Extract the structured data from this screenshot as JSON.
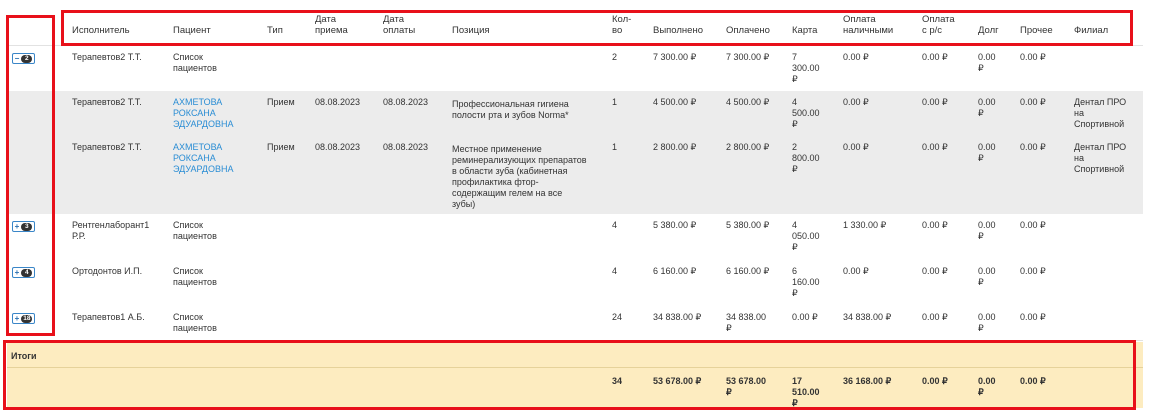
{
  "columns": [
    "Исполнитель",
    "Пациент",
    "Тип",
    "Дата\nприема",
    "Дата\nоплаты",
    "Позиция",
    "Кол-\nво",
    "Выполнено",
    "Оплачено",
    "Карта",
    "Оплата\nналичными",
    "Оплата\nс р/с",
    "Долг",
    "Прочее",
    "Филиал"
  ],
  "rows": [
    {
      "toggle": {
        "sign": "−",
        "count": "2"
      },
      "performer": "Терапевтов2 Т.Т.",
      "patient": "Список\nпациентов",
      "patient_link": false,
      "type": "",
      "date_visit": "",
      "date_pay": "",
      "position": "",
      "qty": "2",
      "done": "7 300.00 ₽",
      "paid": "7 300.00 ₽",
      "card": "7\n300.00\n₽",
      "cash": "0.00 ₽",
      "bank": "0.00 ₽",
      "debt": "0.00\n₽",
      "other": "0.00 ₽",
      "branch": ""
    },
    {
      "toggle": null,
      "performer": "Терапевтов2 Т.Т.",
      "patient": "АХМЕТОВА\nРОКСАНА\nЭДУАРДОВНА",
      "patient_link": true,
      "type": "Прием",
      "date_visit": "08.08.2023",
      "date_pay": "08.08.2023",
      "position": "Профессиональная гигиена\nполости рта и зубов Norma*",
      "qty": "1",
      "done": "4 500.00 ₽",
      "paid": "4 500.00 ₽",
      "card": "4\n500.00\n₽",
      "cash": "0.00 ₽",
      "bank": "0.00 ₽",
      "debt": "0.00\n₽",
      "other": "0.00 ₽",
      "branch": "Дентал ПРО\nна\nСпортивной"
    },
    {
      "toggle": null,
      "performer": "Терапевтов2 Т.Т.",
      "patient": "АХМЕТОВА\nРОКСАНА\nЭДУАРДОВНА",
      "patient_link": true,
      "type": "Прием",
      "date_visit": "08.08.2023",
      "date_pay": "08.08.2023",
      "position": "Местное применение\nреминерализующих препаратов\nв области зуба (кабинетная\nпрофилактика фтор-\nсодержащим гелем на все\nзубы)",
      "qty": "1",
      "done": "2 800.00 ₽",
      "paid": "2 800.00 ₽",
      "card": "2\n800.00\n₽",
      "cash": "0.00 ₽",
      "bank": "0.00 ₽",
      "debt": "0.00\n₽",
      "other": "0.00 ₽",
      "branch": "Дентал ПРО\nна\nСпортивной"
    },
    {
      "toggle": {
        "sign": "+",
        "count": "3"
      },
      "performer": "Рентгенлаборант1\nР.Р.",
      "patient": "Список\nпациентов",
      "patient_link": false,
      "type": "",
      "date_visit": "",
      "date_pay": "",
      "position": "",
      "qty": "4",
      "done": "5 380.00 ₽",
      "paid": "5 380.00 ₽",
      "card": "4\n050.00\n₽",
      "cash": "1 330.00 ₽",
      "bank": "0.00 ₽",
      "debt": "0.00\n₽",
      "other": "0.00 ₽",
      "branch": ""
    },
    {
      "toggle": {
        "sign": "+",
        "count": "4"
      },
      "performer": "Ортодонтов И.П.",
      "patient": "Список\nпациентов",
      "patient_link": false,
      "type": "",
      "date_visit": "",
      "date_pay": "",
      "position": "",
      "qty": "4",
      "done": "6 160.00 ₽",
      "paid": "6 160.00 ₽",
      "card": "6\n160.00\n₽",
      "cash": "0.00 ₽",
      "bank": "0.00 ₽",
      "debt": "0.00\n₽",
      "other": "0.00 ₽",
      "branch": ""
    },
    {
      "toggle": {
        "sign": "+",
        "count": "18"
      },
      "performer": "Терапевтов1 А.Б.",
      "patient": "Список\nпациентов",
      "patient_link": false,
      "type": "",
      "date_visit": "",
      "date_pay": "",
      "position": "",
      "qty": "24",
      "done": "34 838.00 ₽",
      "paid": "34 838.00\n₽",
      "card": "0.00 ₽",
      "cash": "34 838.00 ₽",
      "bank": "0.00 ₽",
      "debt": "0.00\n₽",
      "other": "0.00 ₽",
      "branch": ""
    }
  ],
  "totals": {
    "label": "Итоги",
    "qty": "34",
    "done": "53 678.00 ₽",
    "paid": "53 678.00\n₽",
    "card": "17\n510.00\n₽",
    "cash": "36 168.00 ₽",
    "bank": "0.00 ₽",
    "debt": "0.00\n₽",
    "other": "0.00 ₽"
  },
  "colors": {
    "accent_link": "#2a8dd4",
    "highlight": "#e8101a",
    "totals_bg": "#fdecc0",
    "alt_row": "#ececec"
  }
}
